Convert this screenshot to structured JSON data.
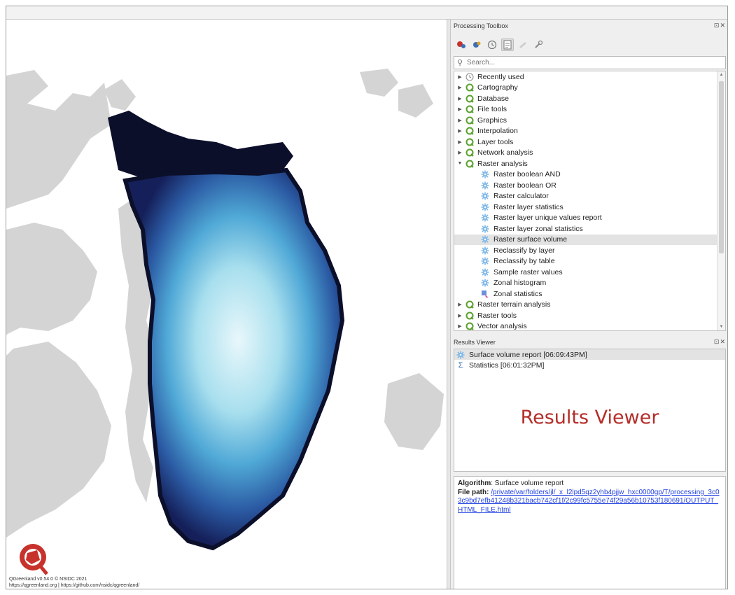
{
  "map": {
    "credit_line1": "QGreenland v0.54.0 © NSIDC 2021",
    "credit_line2": "https://qgreenland.org | https://github.com/nsidc/qgreenland/"
  },
  "processing_toolbox": {
    "title": "Processing Toolbox",
    "controls": "⊡✕",
    "search_placeholder": "Search...",
    "tree": [
      {
        "label": "Recently used",
        "icon": "clock-icon",
        "expanded": false
      },
      {
        "label": "Cartography",
        "icon": "qgis-icon",
        "expanded": false
      },
      {
        "label": "Database",
        "icon": "qgis-icon",
        "expanded": false
      },
      {
        "label": "File tools",
        "icon": "qgis-icon",
        "expanded": false
      },
      {
        "label": "Graphics",
        "icon": "qgis-icon",
        "expanded": false
      },
      {
        "label": "Interpolation",
        "icon": "qgis-icon",
        "expanded": false
      },
      {
        "label": "Layer tools",
        "icon": "qgis-icon",
        "expanded": false
      },
      {
        "label": "Network analysis",
        "icon": "qgis-icon",
        "expanded": false
      },
      {
        "label": "Raster analysis",
        "icon": "qgis-icon",
        "expanded": true
      }
    ],
    "raster_children": [
      {
        "label": "Raster boolean AND",
        "icon": "gear-icon"
      },
      {
        "label": "Raster boolean OR",
        "icon": "gear-icon"
      },
      {
        "label": "Raster calculator",
        "icon": "gear-icon"
      },
      {
        "label": "Raster layer statistics",
        "icon": "gear-icon"
      },
      {
        "label": "Raster layer unique values report",
        "icon": "gear-icon"
      },
      {
        "label": "Raster layer zonal statistics",
        "icon": "gear-icon"
      },
      {
        "label": "Raster surface volume",
        "icon": "gear-icon",
        "selected": true
      },
      {
        "label": "Reclassify by layer",
        "icon": "gear-icon"
      },
      {
        "label": "Reclassify by table",
        "icon": "gear-icon"
      },
      {
        "label": "Sample raster values",
        "icon": "gear-icon"
      },
      {
        "label": "Zonal histogram",
        "icon": "gear-icon"
      },
      {
        "label": "Zonal statistics",
        "icon": "zonal-statistics-icon"
      }
    ],
    "tree_after": [
      {
        "label": "Raster terrain analysis",
        "icon": "qgis-icon"
      },
      {
        "label": "Raster tools",
        "icon": "qgis-icon"
      },
      {
        "label": "Vector analysis",
        "icon": "qgis-icon"
      }
    ]
  },
  "results_viewer": {
    "title": "Results Viewer",
    "controls": "⊡✕",
    "items": [
      {
        "label": "Surface volume report [06:09:43PM]",
        "icon": "gear-icon",
        "selected": true
      },
      {
        "label": "Statistics [06:01:32PM]",
        "icon": "sigma-icon",
        "selected": false
      }
    ],
    "overlay_label": "Results Viewer",
    "detail": {
      "algorithm_label": "Algorithm",
      "algorithm_value": ": Surface volume report",
      "file_path_label": "File path",
      "file_path_sep": ": ",
      "file_path_value": "/private/var/folders/jl/_x_l2lpd5qz2yhb4pjjw_hxc0000gp/T/processing_3c03c9bd7efb41248b321bacb742cf1f/2c99fc5755e74f29a56b10753f180691/OUTPUT_HTML_FILE.html"
    }
  },
  "colors": {
    "accent_red": "#b52d28",
    "link_blue": "#1f3fe0",
    "land_gray": "#d4d4d4",
    "ice_dark": "#0b0f2a",
    "ice_light": "#e8f7fb"
  }
}
